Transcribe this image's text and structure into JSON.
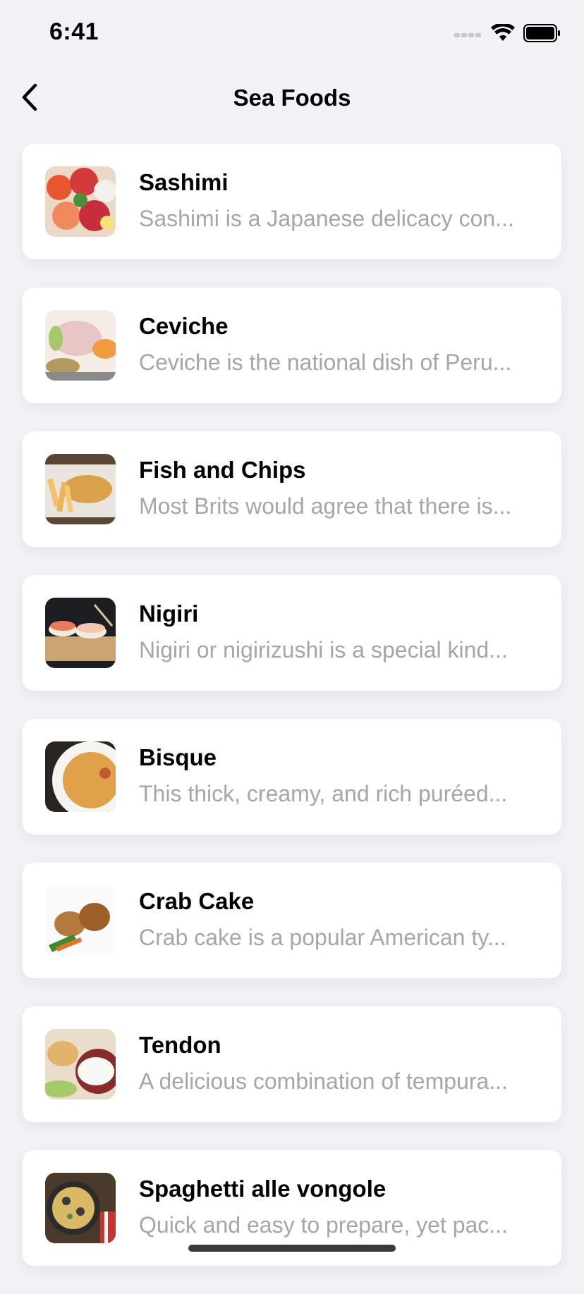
{
  "status_bar": {
    "time": "6:41"
  },
  "nav": {
    "title": "Sea Foods",
    "back_icon": "chevron-left-icon"
  },
  "items": [
    {
      "title": "Sashimi",
      "description": "Sashimi is a Japanese delicacy con..."
    },
    {
      "title": "Ceviche",
      "description": "Ceviche is the national dish of Peru..."
    },
    {
      "title": "Fish and Chips",
      "description": "Most Brits would agree that there is..."
    },
    {
      "title": "Nigiri",
      "description": "Nigiri or nigirizushi is a special kind..."
    },
    {
      "title": "Bisque",
      "description": "This thick, creamy, and rich puréed..."
    },
    {
      "title": "Crab Cake",
      "description": "Crab cake is a popular American ty..."
    },
    {
      "title": "Tendon",
      "description": "A delicious combination of tempura..."
    },
    {
      "title": "Spaghetti alle vongole",
      "description": "Quick and easy to prepare, yet pac..."
    }
  ],
  "colors": {
    "background": "#f1f1f6",
    "card": "#ffffff",
    "subtitle": "#a5a5aa"
  }
}
